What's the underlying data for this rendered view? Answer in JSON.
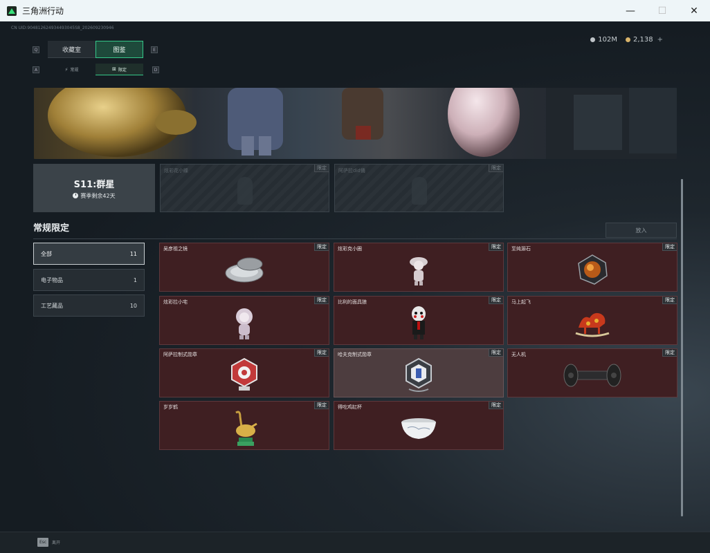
{
  "window": {
    "title": "三角洲行动",
    "minimize": "—",
    "maximize": "☐",
    "close": "✕"
  },
  "header": {
    "uid": "CN UID:904812624934493045S8_202609230946",
    "currency": [
      {
        "icon": "silver-coin-icon",
        "value": "102M"
      },
      {
        "icon": "gold-coin-icon",
        "value": "2,138",
        "plus": "+"
      }
    ]
  },
  "tabs": {
    "main": [
      {
        "label": "收藏室",
        "active": false
      },
      {
        "label": "图鉴",
        "active": true
      }
    ],
    "sub": [
      {
        "label": "常规",
        "icon": "⚡",
        "active": false
      },
      {
        "label": "限定",
        "icon": "⊠",
        "active": true
      }
    ],
    "hints": [
      "Q",
      "E",
      "A",
      "D"
    ]
  },
  "season": {
    "title": "S11:群星",
    "remaining": "赛季剩余42天"
  },
  "featured": [
    {
      "name": "炫彩花小蝶",
      "tag": "限定"
    },
    {
      "name": "阿萨拉did俑",
      "tag": "限定"
    }
  ],
  "section": {
    "title": "常规限定",
    "put_button": "放入"
  },
  "filters": [
    {
      "label": "全部",
      "count": "11",
      "active": true
    },
    {
      "label": "电子物品",
      "count": "1",
      "active": false
    },
    {
      "label": "工艺藏品",
      "count": "10",
      "active": false
    }
  ],
  "items": [
    {
      "name": "吴彦祖之镜",
      "tag": "限定",
      "icon": "mirror-icon"
    },
    {
      "name": "炫彩克小圈",
      "tag": "限定",
      "icon": "doll-icon"
    },
    {
      "name": "至纯源石",
      "tag": "限定",
      "icon": "gem-icon"
    },
    {
      "name": "炫彩拉小宅",
      "tag": "限定",
      "icon": "doll-icon"
    },
    {
      "name": "比利的面具狼",
      "tag": "限定",
      "icon": "puppet-icon"
    },
    {
      "name": "马上起飞",
      "tag": "限定",
      "icon": "rocking-horse-icon"
    },
    {
      "name": "阿萨拉制式勋章",
      "tag": "限定",
      "icon": "medal-icon"
    },
    {
      "name": "哈夫克制式勋章",
      "tag": "限定",
      "icon": "badge-icon"
    },
    {
      "name": "无人机",
      "tag": "限定",
      "icon": "drone-icon"
    },
    {
      "name": "岁岁鹤",
      "tag": "限定",
      "icon": "crane-icon"
    },
    {
      "name": "得吃鸡缸杯",
      "tag": "限定",
      "icon": "bowl-icon"
    }
  ],
  "bottom": {
    "esc_key": "Esc",
    "esc_label": "离开"
  }
}
